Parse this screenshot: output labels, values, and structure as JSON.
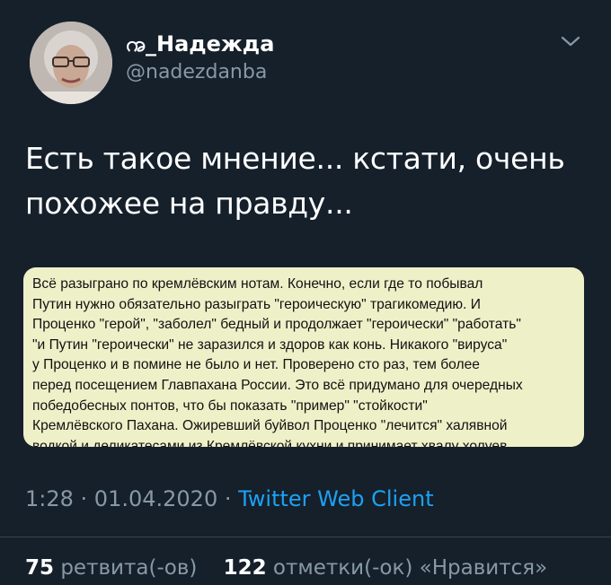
{
  "user": {
    "display_name": "ꩠ_Надежда",
    "handle": "@nadezdanba"
  },
  "icons": {
    "menu": "chevron-down-icon",
    "avatar": "profile-photo"
  },
  "tweet": {
    "text_lines": [
      "Есть такое мнение... кстати, очень",
      "похожее на правду..."
    ],
    "image_lines": [
      "Всё разыграно по кремлёвским нотам. Конечно, если где то побывал",
      "Путин нужно обязательно разыграть \"героическую\" трагикомедию. И",
      "Проценко \"герой\", \"заболел\" бедный и продолжает \"героически\" \"работать\"",
      "\"и Путин  \"героически\" не заразился и здоров как конь. Никакого \"вируса\"",
      "у Проценко и в помине не было и нет. Проверено сто раз, тем более",
      "перед посещением Главпахана России. Это всё придумано для очередных",
      "победобесных понтов, что бы показать \"пример\" \"стойкости\"",
      "Кремлёвского Пахана. Ожиревший буйвол Проценко \"лечится\" халявной",
      "водкой и деликатесами из Кремлёвской кухни и принимает хвалу холуев."
    ]
  },
  "meta": {
    "time": "1:28",
    "sep1": " · ",
    "date": "01.04.2020",
    "sep2": " · ",
    "source": "Twitter Web Client"
  },
  "stats": {
    "retweets_count": "75",
    "retweets_label": " ретвита(-ов)",
    "likes_count": "122",
    "likes_label": " отметки(-ок) «Нравится»"
  },
  "colors": {
    "background": "#15202b",
    "secondary_text": "#8899a6",
    "link": "#1da1f2",
    "note_bg": "#eef0c8"
  }
}
